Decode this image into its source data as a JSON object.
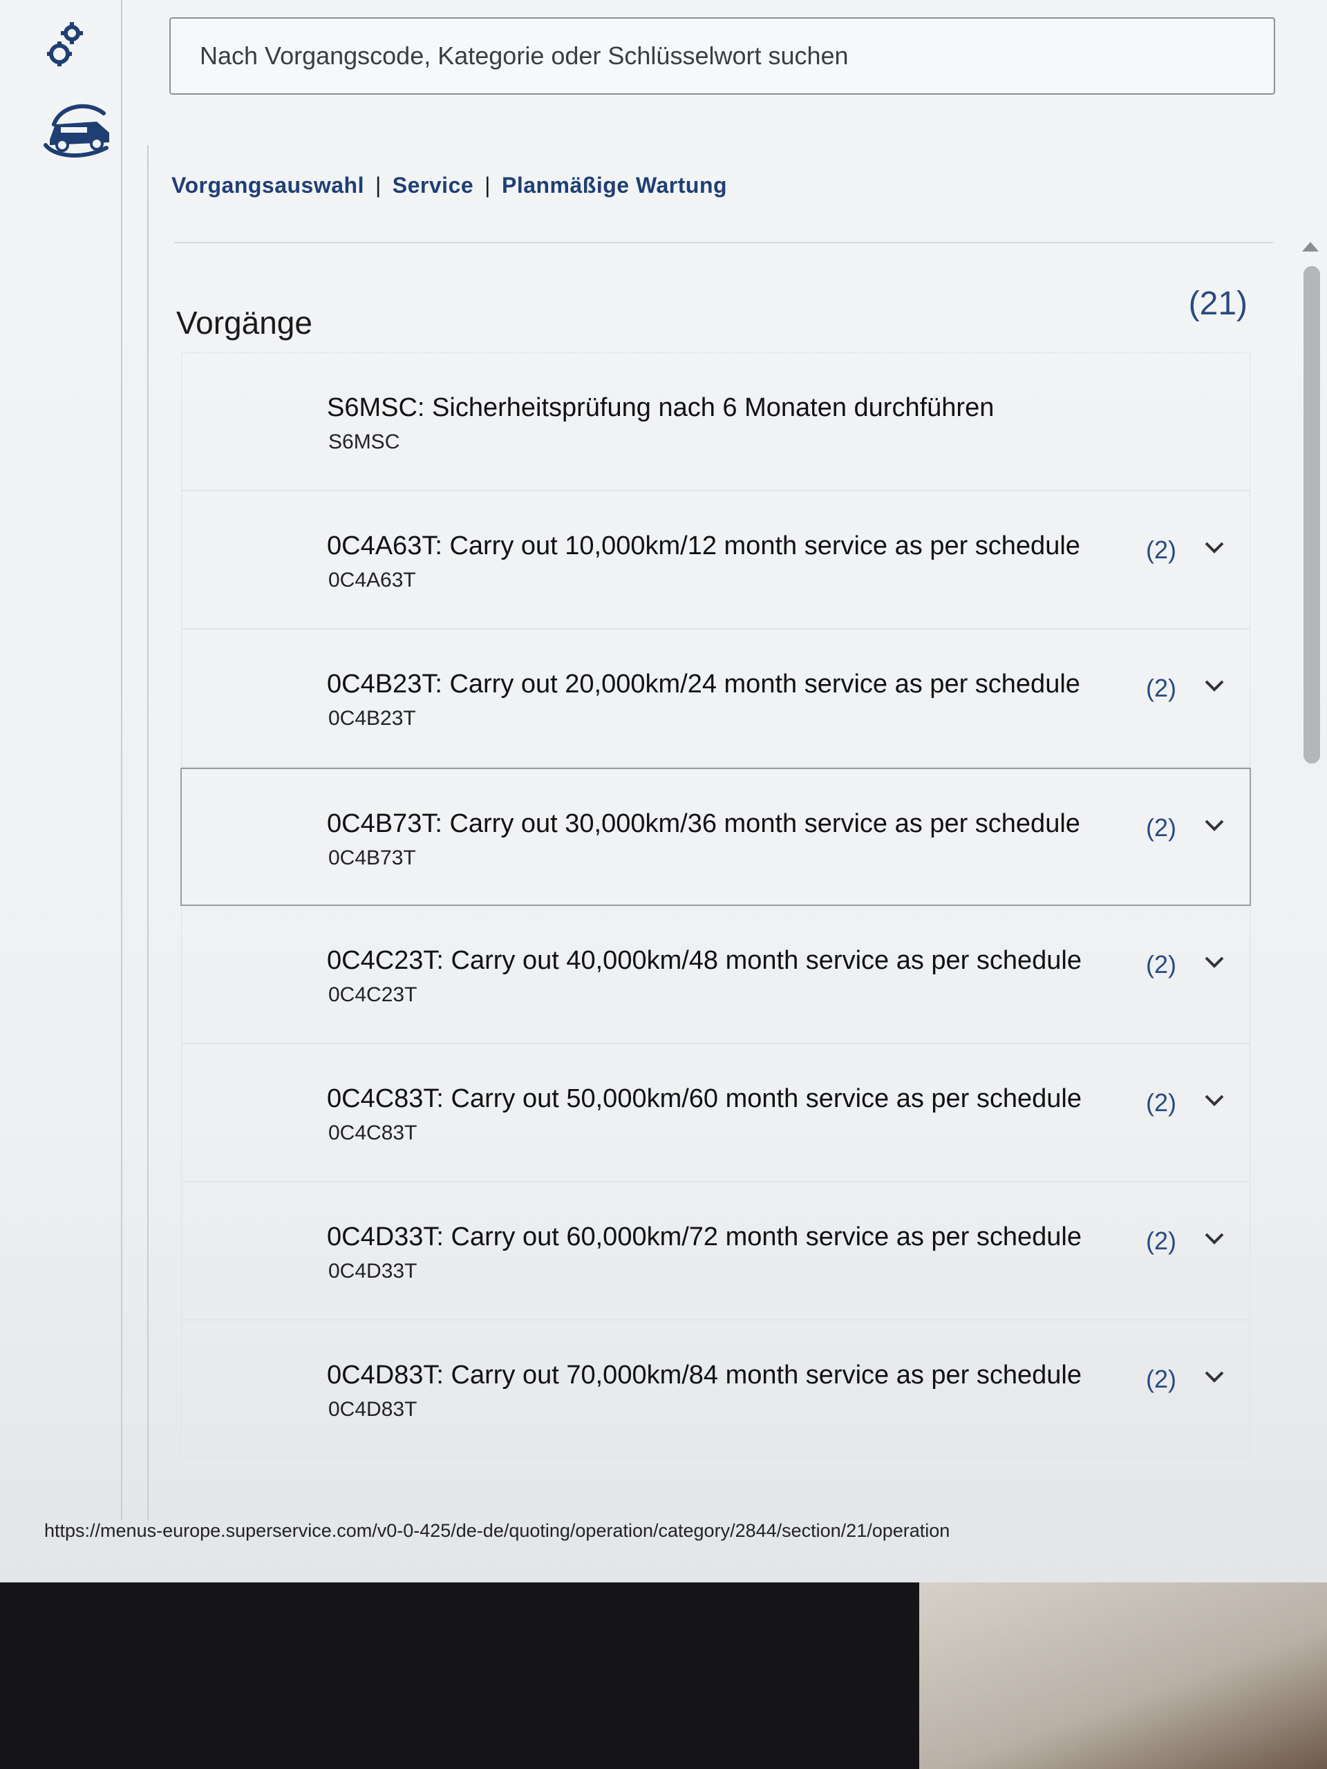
{
  "search": {
    "placeholder": "Nach Vorgangscode, Kategorie oder Schlüsselwort suchen"
  },
  "breadcrumb": {
    "items": [
      "Vorgangsauswahl",
      "Service",
      "Planmäßige Wartung"
    ],
    "separator": "|"
  },
  "section": {
    "title": "Vorgänge",
    "count": "(21)"
  },
  "operations": [
    {
      "title": "S6MSC: Sicherheitsprüfung nach 6 Monaten durchführen",
      "code": "S6MSC",
      "count": "",
      "expandable": false
    },
    {
      "title": "0C4A63T: Carry out 10,000km/12 month service as per schedule",
      "code": "0C4A63T",
      "count": "(2)",
      "expandable": true
    },
    {
      "title": "0C4B23T: Carry out 20,000km/24 month service as per schedule",
      "code": "0C4B23T",
      "count": "(2)",
      "expandable": true
    },
    {
      "title": "0C4B73T: Carry out 30,000km/36 month service as per schedule",
      "code": "0C4B73T",
      "count": "(2)",
      "expandable": true,
      "selected": true
    },
    {
      "title": "0C4C23T: Carry out 40,000km/48 month service as per schedule",
      "code": "0C4C23T",
      "count": "(2)",
      "expandable": true
    },
    {
      "title": "0C4C83T: Carry out 50,000km/60 month service as per schedule",
      "code": "0C4C83T",
      "count": "(2)",
      "expandable": true
    },
    {
      "title": "0C4D33T: Carry out 60,000km/72 month service as per schedule",
      "code": "0C4D33T",
      "count": "(2)",
      "expandable": true
    },
    {
      "title": "0C4D83T: Carry out 70,000km/84 month service as per schedule",
      "code": "0C4D83T",
      "count": "(2)",
      "expandable": true
    }
  ],
  "footer": {
    "url": "https://menus-europe.superservice.com/v0-0-425/de-de/quoting/operation/category/2844/section/21/operation"
  },
  "icons": {
    "settings": "gears-icon",
    "vehicle": "car-service-icon",
    "expand": "chevron-down-icon"
  },
  "colors": {
    "accent": "#1f3f73",
    "count": "#2a4a80",
    "background": "#f3f4f6"
  }
}
